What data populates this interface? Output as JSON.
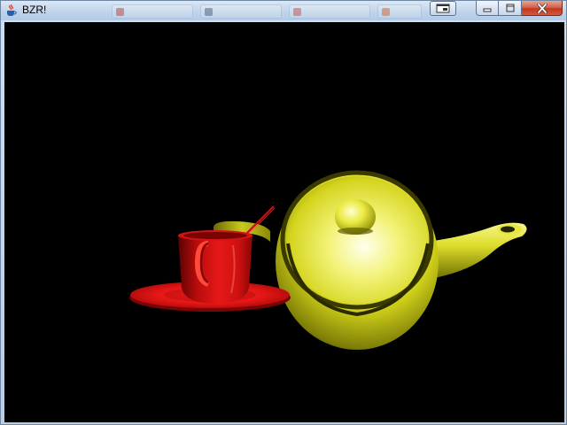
{
  "window": {
    "title": "BZR!",
    "app_icon": "java-coffee-cup-icon",
    "controls": {
      "extra": "switch-window-icon",
      "minimize": "minimize-icon",
      "maximize": "maximize-icon",
      "close": "close-icon"
    }
  },
  "scene": {
    "background_color": "#000000",
    "objects": [
      {
        "name": "teapot",
        "color": "#e8e82a"
      },
      {
        "name": "teacup",
        "color": "#d41010"
      },
      {
        "name": "saucer",
        "color": "#e01414"
      },
      {
        "name": "spoon-handle",
        "color": "#c01010"
      }
    ]
  }
}
